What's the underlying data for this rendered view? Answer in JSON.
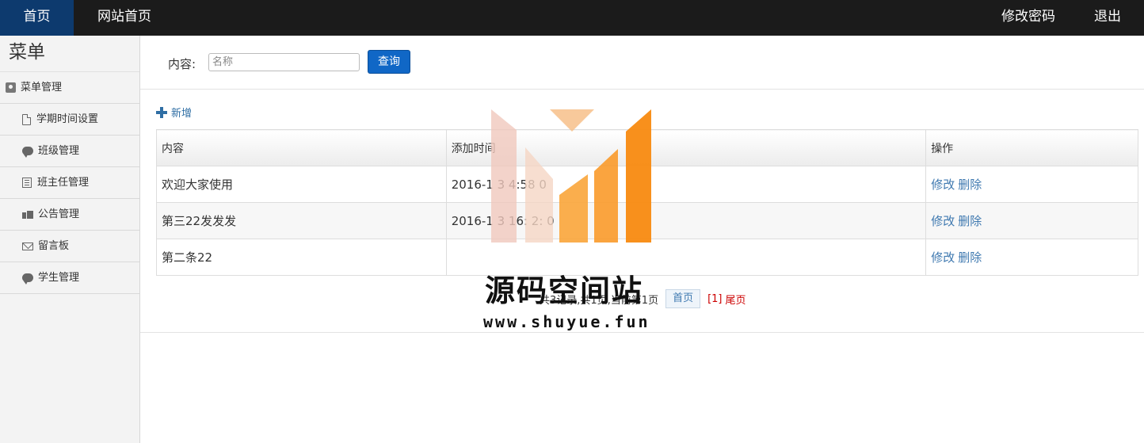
{
  "topnav": {
    "home": "首页",
    "site_home": "网站首页",
    "change_password": "修改密码",
    "logout": "退出"
  },
  "sidebar": {
    "title": "菜单",
    "group": "菜单管理",
    "items": [
      {
        "label": "学期时间设置",
        "icon": "file-icon"
      },
      {
        "label": "班级管理",
        "icon": "comment-icon"
      },
      {
        "label": "班主任管理",
        "icon": "list-icon"
      },
      {
        "label": "公告管理",
        "icon": "bullhorn-icon"
      },
      {
        "label": "留言板",
        "icon": "envelope-icon"
      },
      {
        "label": "学生管理",
        "icon": "comment-icon"
      }
    ]
  },
  "search": {
    "label": "内容:",
    "placeholder": "名称",
    "button": "查询"
  },
  "toolbar": {
    "add_label": "新增"
  },
  "table": {
    "headers": [
      "内容",
      "添加时间",
      "操作"
    ],
    "rows": [
      {
        "content": "欢迎大家使用",
        "time": "2016-1  3     4:58  0",
        "edit": "修改",
        "delete": "删除"
      },
      {
        "content": "第三22发发发",
        "time": "2016-1  3 16:  2:  0",
        "edit": "修改",
        "delete": "删除"
      },
      {
        "content": "第二条22",
        "time": "",
        "edit": "修改",
        "delete": "删除"
      }
    ]
  },
  "pager": {
    "info": "共3记录,共1页,当前第1页",
    "first": "首页",
    "current": "[1]",
    "last": "尾页"
  },
  "watermark": {
    "text": "源码空间站",
    "url": "www.shuyue.fun"
  }
}
